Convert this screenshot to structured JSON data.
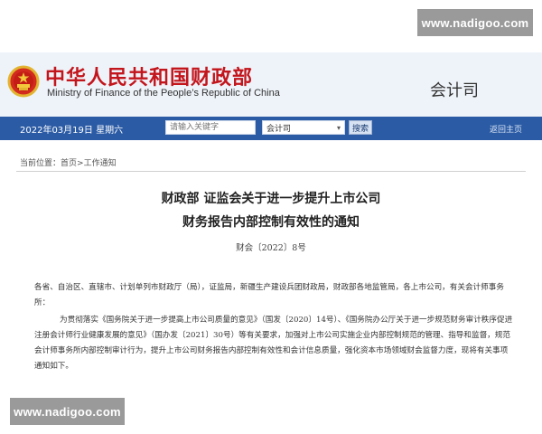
{
  "watermarks": {
    "top": "www.nadigoo.com",
    "bottom": "www.nadigoo.com"
  },
  "header": {
    "title_cn": "中华人民共和国财政部",
    "title_en": "Ministry of Finance of the People’s Republic of China",
    "department": "会计司",
    "emblem_icon": "national-emblem-icon"
  },
  "navbar": {
    "date": "2022年03月19日 星期六",
    "search_placeholder": "请输入关键字",
    "select_value": "会计司",
    "search_button": "搜索",
    "back_home": "返回主页"
  },
  "breadcrumb": {
    "prefix": "当前位置：",
    "home": "首页",
    "separator": ">",
    "current": "工作通知"
  },
  "document": {
    "title_line1": "财政部 证监会关于进一步提升上市公司",
    "title_line2": "财务报告内部控制有效性的通知",
    "doc_number": "财会〔2022〕8号",
    "para1": "各省、自治区、直辖市、计划单列市财政厅（局），证监局，新疆生产建设兵团财政局，财政部各地监管局，各上市公司，有关会计师事务所：",
    "para2": "为贯彻落实《国务院关于进一步提高上市公司质量的意见》（国发〔2020〕14号）、《国务院办公厅关于进一步规范财务审计秩序促进注册会计师行业健康发展的意见》（国办发〔2021〕30号）等有关要求，加强对上市公司实施企业内部控制规范的管理、指导和监督，规范会计师事务所内部控制审计行为，提升上市公司财务报告内部控制有效性和会计信息质量，强化资本市场领域财会监督力度，现将有关事项通知如下。"
  },
  "colors": {
    "navbar": "#2b5ba5",
    "title_red": "#c3151c",
    "header_bg": "#eef3f9",
    "watermark_bg": "#9a9a9a"
  }
}
